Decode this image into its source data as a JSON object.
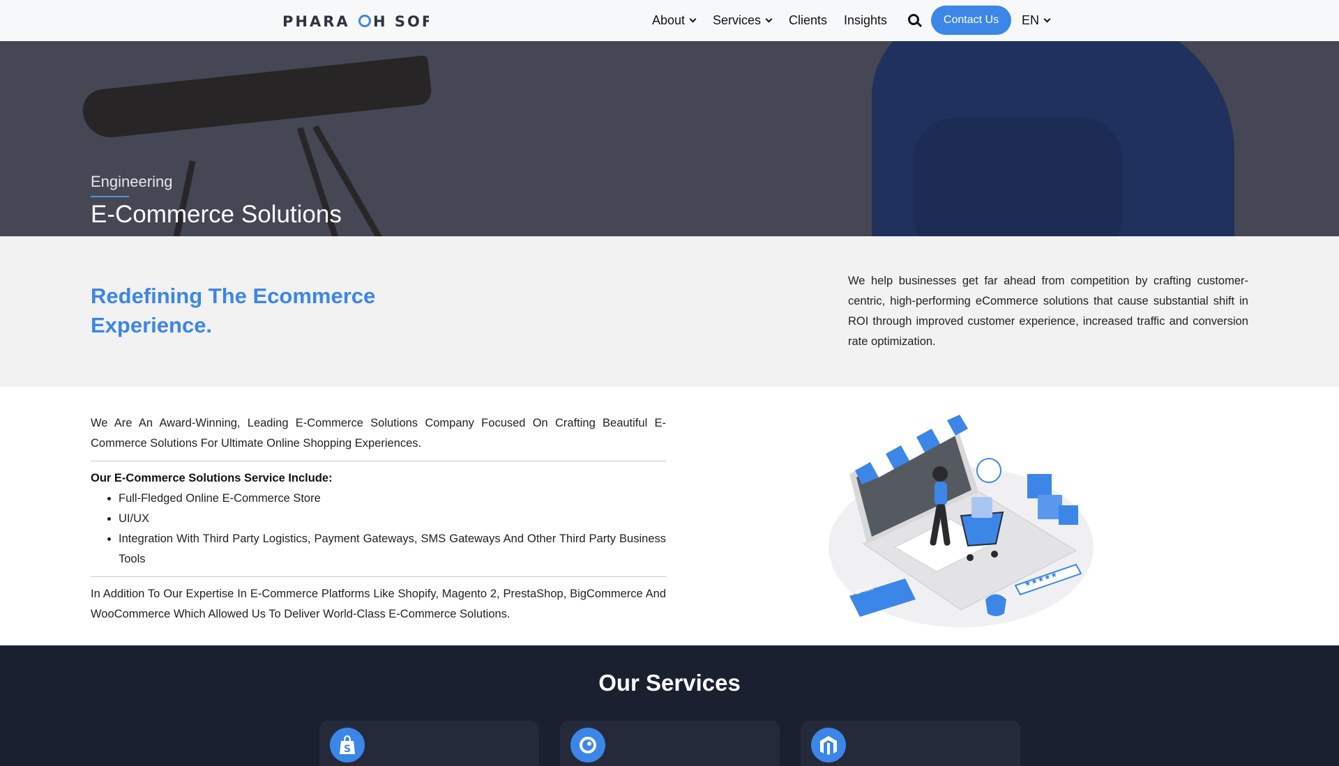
{
  "nav": {
    "logo": "PHARAOH SOFT",
    "items": [
      {
        "label": "About",
        "dropdown": true
      },
      {
        "label": "Services",
        "dropdown": true
      },
      {
        "label": "Clients",
        "dropdown": false
      },
      {
        "label": "Insights",
        "dropdown": false
      }
    ],
    "search_icon": "search-icon",
    "contact_label": "Contact Us",
    "language": "EN"
  },
  "hero": {
    "kicker": "Engineering",
    "title": "E-Commerce Solutions"
  },
  "intro": {
    "heading": "Redefining The Ecommerce Experience.",
    "description": "We help businesses get far ahead from competition by crafting customer-centric, high-performing eCommerce solutions that cause substantial shift in ROI through improved customer experience, increased traffic and conversion rate optimization."
  },
  "content": {
    "lead": "We Are An Award-Winning, Leading E-Commerce Solutions Company Focused On Crafting Beautiful E-Commerce Solutions For Ultimate Online Shopping Experiences.",
    "list_title": "Our E-Commerce Solutions Service Include:",
    "features": [
      "Full-Fledged Online E-Commerce Store",
      "UI/UX",
      "Integration With Third Party Logistics, Payment Gateways, SMS Gateways And Other Third Party Business Tools"
    ],
    "closing": "In Addition To Our Expertise In E-Commerce Platforms Like Shopify, Magento 2, PrestaShop, BigCommerce And WooCommerce Which Allowed Us To Deliver World-Class E-Commerce Solutions.",
    "illustration": {
      "card_label": "BANK",
      "rating": "★★★★★"
    }
  },
  "services": {
    "heading": "Our Services",
    "cards": [
      {
        "icon": "shopify-icon"
      },
      {
        "icon": "prestashop-icon"
      },
      {
        "icon": "magento-icon"
      }
    ]
  },
  "colors": {
    "accent": "#3c86e8",
    "nav_bg": "#f7f8fa",
    "intro_bg": "#f2f2f3",
    "services_bg": "#1b2031",
    "card_bg": "#252a3b"
  }
}
